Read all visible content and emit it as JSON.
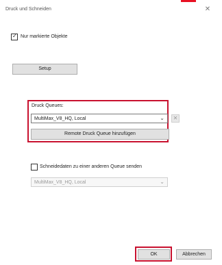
{
  "window": {
    "title": "Druck und Schneiden",
    "close_glyph": "✕"
  },
  "options": {
    "only_selected_label": "Nur markierte Objekte",
    "only_selected_checked": true
  },
  "setup": {
    "label": "Setup"
  },
  "queues": {
    "label": "Druck Queues:",
    "selected": "MultiMax_V8_HQ, Local",
    "add_remote_label": "Remote Druck Queue hinzufügen",
    "delete_glyph": "✕"
  },
  "cut": {
    "checkbox_label": "Schneidedaten zu einer anderen Queue senden",
    "checked": false,
    "queue_selected": "MultiMax_V8_HQ, Local"
  },
  "footer": {
    "ok_label": "OK",
    "cancel_label": "Abbrechen"
  },
  "colors": {
    "highlight": "#c8102e",
    "close_hover": "#e81123"
  }
}
